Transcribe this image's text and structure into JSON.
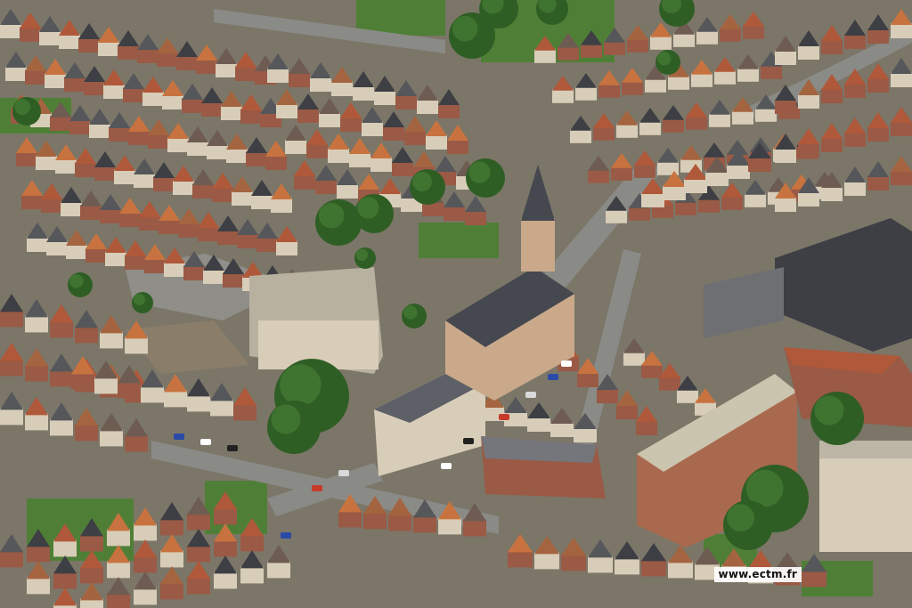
{
  "photo": {
    "watermark_text": "www.ectm.fr",
    "palette": {
      "ground": "#7b7668",
      "road": "#8a8a86",
      "grass": "#4f7f36",
      "tree": "#2f5e25",
      "roof_red": "#b0583a",
      "roof_orange": "#c8733f",
      "roof_grey": "#55575a",
      "roof_dark": "#3d3f44",
      "wall_brick": "#9a5a45",
      "wall_light": "#d8cdb8",
      "flat_roof": "#b9b1a0",
      "church_roof": "#45484f",
      "church_wall": "#c9a98a"
    }
  }
}
